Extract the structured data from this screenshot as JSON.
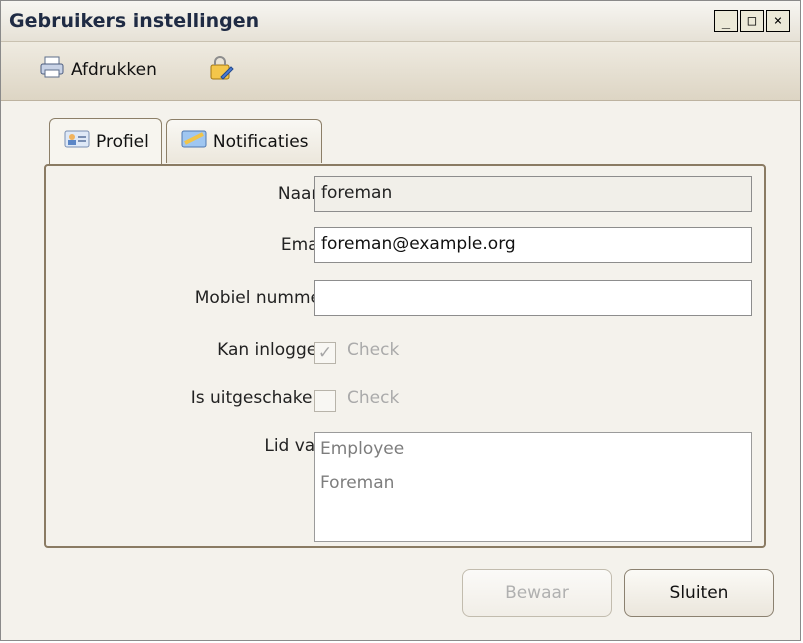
{
  "window": {
    "title": "Gebruikers instellingen",
    "minimize_label": "_",
    "maximize_label": "□",
    "close_label": "×"
  },
  "toolbar": {
    "print_label": "Afdrukken",
    "print_icon": "printer-icon",
    "lock_icon": "lock-edit-icon"
  },
  "tabs": [
    {
      "label": "Profiel",
      "icon": "user-card-icon",
      "active": true
    },
    {
      "label": "Notificaties",
      "icon": "notification-icon",
      "active": false
    }
  ],
  "form": {
    "naam": {
      "label": "Naam",
      "value": "foreman",
      "readonly": true
    },
    "email": {
      "label": "Email",
      "value": "foreman@example.org"
    },
    "mobiel": {
      "label": "Mobiel nummer",
      "value": ""
    },
    "kan_inloggen": {
      "label": "Kan inloggen",
      "checked": true,
      "check_label": "Check"
    },
    "is_uitgeschakeld": {
      "label": "Is uitgeschakeld",
      "checked": false,
      "check_label": "Check"
    },
    "lid_van": {
      "label": "Lid van",
      "items": [
        "Employee",
        "Foreman"
      ]
    }
  },
  "buttons": {
    "save_label": "Bewaar",
    "close_label": "Sluiten"
  },
  "colors": {
    "title_text": "#1f2b44",
    "panel_border": "#8a7b63",
    "disabled_text": "#b0b0b0"
  }
}
